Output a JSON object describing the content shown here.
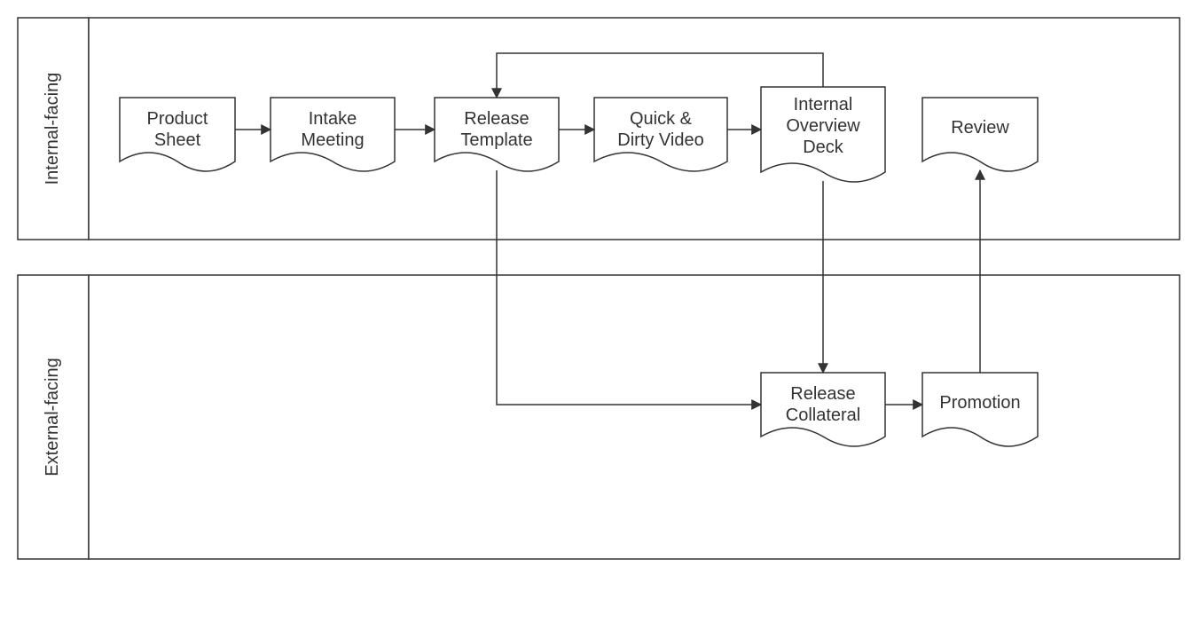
{
  "lanes": {
    "internal": "Internal-facing",
    "external": "External-facing"
  },
  "nodes": {
    "product_sheet_l1": "Product",
    "product_sheet_l2": "Sheet",
    "intake_meeting_l1": "Intake",
    "intake_meeting_l2": "Meeting",
    "release_template_l1": "Release",
    "release_template_l2": "Template",
    "quick_dirty_l1": "Quick &",
    "quick_dirty_l2": "Dirty Video",
    "overview_deck_l1": "Internal",
    "overview_deck_l2": "Overview",
    "overview_deck_l3": "Deck",
    "review": "Review",
    "release_collateral_l1": "Release",
    "release_collateral_l2": "Collateral",
    "promotion": "Promotion"
  }
}
